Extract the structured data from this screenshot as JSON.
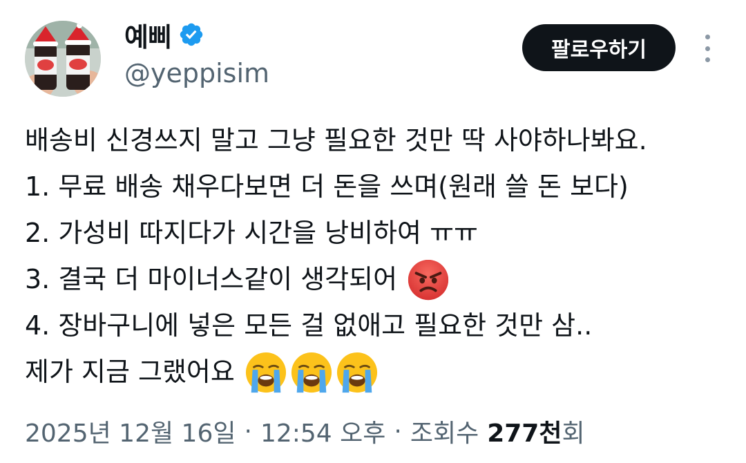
{
  "user": {
    "display_name": "예삐",
    "handle": "@yeppisim",
    "verified_icon": "verified-badge-icon",
    "accent": "#1d9bf0"
  },
  "actions": {
    "follow_label": "팔로우하기",
    "more_icon": "more-vertical-icon"
  },
  "tweet": {
    "lines": [
      "배송비 신경쓰지 말고 그냥 필요한 것만 딱 사야하나봐요.",
      "1. 무료 배송 채우다보면 더 돈을 쓰며(원래 쓸 돈 보다)",
      "2. 가성비 따지다가 시간을 낭비하여 ㅠㅠ",
      "3. 결국 더 마이너스같이 생각되어",
      "4. 장바구니에 넣은 모든 걸 없애고 필요한 것만 삼..",
      "제가 지금 그랬어요"
    ],
    "emojis": {
      "line3": "angry-face-emoji",
      "line6": [
        "loudly-crying-face-emoji",
        "loudly-crying-face-emoji",
        "loudly-crying-face-emoji"
      ]
    }
  },
  "meta": {
    "date": "2025년 12월 16일",
    "separator": "·",
    "time": "12:54 오후",
    "views_label": "조회수",
    "views_count": "277천",
    "views_suffix": "회"
  }
}
